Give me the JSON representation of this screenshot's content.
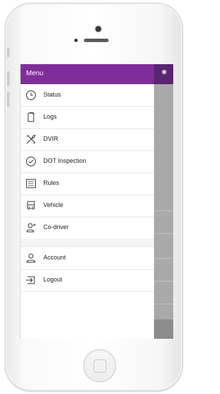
{
  "app": {
    "header_title": "Menu",
    "header_icon": "bluetooth-icon"
  },
  "menu": {
    "items": [
      {
        "label": "Status",
        "icon": "clock-icon"
      },
      {
        "label": "Logs",
        "icon": "document-icon"
      },
      {
        "label": "DVIR",
        "icon": "tools-icon"
      },
      {
        "label": "DOT Inspection",
        "icon": "check-circle-icon"
      },
      {
        "label": "Rules",
        "icon": "list-icon"
      },
      {
        "label": "Vehicle",
        "icon": "truck-icon"
      },
      {
        "label": "Co-driver",
        "icon": "co-driver-icon"
      }
    ],
    "secondary": [
      {
        "label": "Account",
        "icon": "user-icon"
      },
      {
        "label": "Logout",
        "icon": "logout-icon"
      }
    ]
  },
  "colors": {
    "header": "#7f2d9a",
    "header_right": "#5a2470",
    "overlay": "#a9a9a9"
  }
}
